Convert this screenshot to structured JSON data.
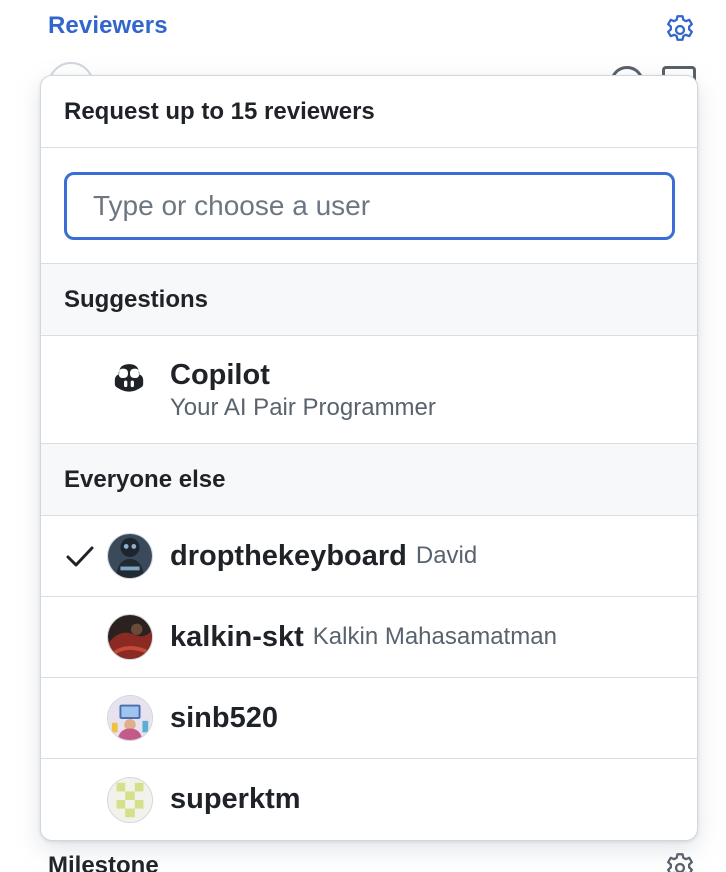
{
  "sidebar": {
    "reviewers_heading": "Reviewers",
    "milestone_heading": "Milestone"
  },
  "popover": {
    "title": "Request up to 15 reviewers",
    "filter_placeholder": "Type or choose a user",
    "sections": {
      "suggestions_label": "Suggestions",
      "everyone_else_label": "Everyone else"
    },
    "suggestion": {
      "name": "Copilot",
      "description": "Your AI Pair Programmer",
      "icon": "copilot-icon"
    },
    "users": [
      {
        "login": "dropthekeyboard",
        "full_name": "David",
        "selected": true
      },
      {
        "login": "kalkin-skt",
        "full_name": "Kalkin Mahasamatman",
        "selected": false
      },
      {
        "login": "sinb520",
        "full_name": "",
        "selected": false
      },
      {
        "login": "superktm",
        "full_name": "",
        "selected": false
      }
    ]
  },
  "colors": {
    "link_blue": "#3366cc",
    "focus_border": "#3a6ed6",
    "section_bg": "#f6f8fa",
    "muted_text": "#59636e"
  }
}
